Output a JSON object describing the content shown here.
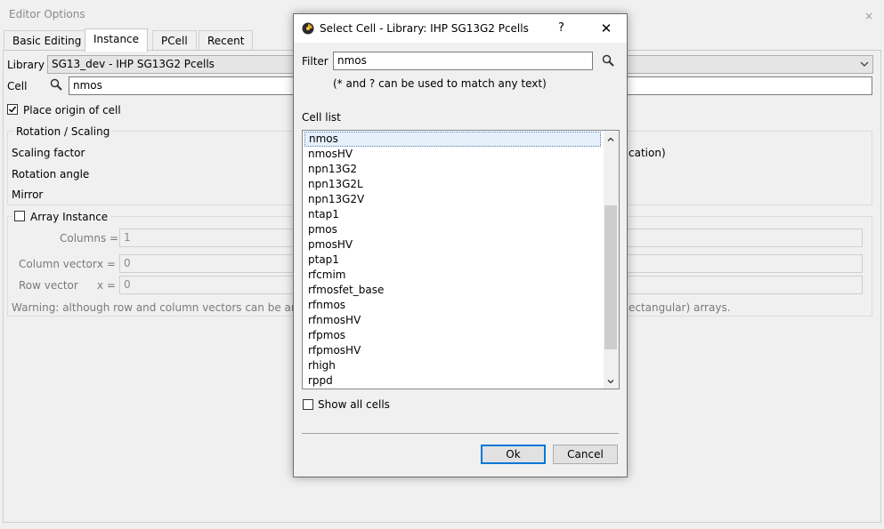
{
  "window": {
    "title": "Editor Options",
    "close_glyph": "×"
  },
  "tabs": [
    "Basic Editing",
    "Instance",
    "PCell",
    "Recent"
  ],
  "instance": {
    "library_label": "Library",
    "library_value": "SG13_dev - IHP SG13G2 Pcells",
    "cell_label": "Cell",
    "cell_value": "nmos",
    "place_origin_label": "Place origin of cell",
    "place_origin_checked": true,
    "rotation_group_label": "Rotation / Scaling",
    "scaling_factor_label": "Scaling factor",
    "scaling_partial_text": "cation)",
    "rotation_angle_label": "Rotation angle",
    "mirror_label": "Mirror",
    "array_label": "Array Instance",
    "array_checked": false,
    "columns_label": "Columns =",
    "columns_value": "1",
    "column_vector_label": "Column vector",
    "row_vector_label": "Row vector",
    "x_eq": "x =",
    "column_vector_x": "0",
    "row_vector_x": "0",
    "warning_left": "Warning: although row and column vectors can be arbi",
    "warning_right": "ectangular) arrays."
  },
  "dialog": {
    "title": "Select Cell - Library: IHP SG13G2 Pcells",
    "help_glyph": "?",
    "close_glyph": "✕",
    "filter_label": "Filter",
    "filter_value": "nmos",
    "filter_hint": "(* and ? can be used to match any text)",
    "cell_list_label": "Cell list",
    "cells": [
      "nmos",
      "nmosHV",
      "npn13G2",
      "npn13G2L",
      "npn13G2V",
      "ntap1",
      "pmos",
      "pmosHV",
      "ptap1",
      "rfcmim",
      "rfmosfet_base",
      "rfnmos",
      "rfnmosHV",
      "rfpmos",
      "rfpmosHV",
      "rhigh",
      "rppd"
    ],
    "selected_cell": "nmos",
    "show_all_label": "Show all cells",
    "show_all_checked": false,
    "ok_label": "Ok",
    "cancel_label": "Cancel"
  },
  "icons": [
    "search-icon",
    "chevron-down-icon",
    "app-logo-icon",
    "help-icon",
    "close-icon",
    "checkmark-icon",
    "scroll-up-icon",
    "scroll-down-icon"
  ]
}
